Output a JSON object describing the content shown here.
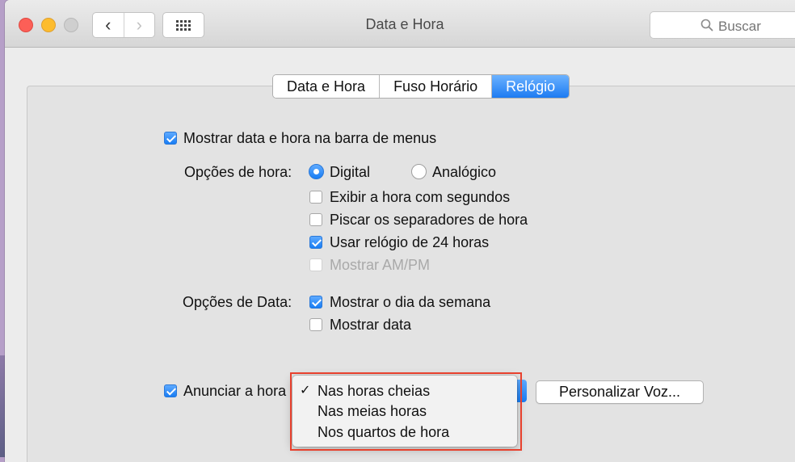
{
  "window": {
    "title": "Data e Hora",
    "search_placeholder": "Buscar"
  },
  "tabs": [
    {
      "label": "Data e Hora",
      "active": false
    },
    {
      "label": "Fuso Horário",
      "active": false
    },
    {
      "label": "Relógio",
      "active": true
    }
  ],
  "clock": {
    "show_menubar": {
      "label": "Mostrar data e hora na barra de menus",
      "checked": true
    },
    "time_options_label": "Opções de hora:",
    "digital": {
      "label": "Digital",
      "selected": true
    },
    "analog": {
      "label": "Analógico",
      "selected": false
    },
    "show_seconds": {
      "label": "Exibir a hora com segundos",
      "checked": false
    },
    "flash_separators": {
      "label": "Piscar os separadores de hora",
      "checked": false
    },
    "use_24h": {
      "label": "Usar relógio de 24 horas",
      "checked": true
    },
    "show_ampm": {
      "label": "Mostrar AM/PM",
      "checked": false,
      "disabled": true
    },
    "date_options_label": "Opções de Data:",
    "show_weekday": {
      "label": "Mostrar o dia da semana",
      "checked": true
    },
    "show_date": {
      "label": "Mostrar data",
      "checked": false
    },
    "announce": {
      "label": "Anunciar a hora",
      "checked": true
    },
    "customize_voice": "Personalizar Voz..."
  },
  "announce_menu": {
    "check_glyph": "✓",
    "options": [
      "Nas horas cheias",
      "Nas meias horas",
      "Nos quartos de hora"
    ],
    "selected_index": 0
  },
  "colors": {
    "accent": "#1d7bf2",
    "close": "#fc5f57",
    "minimize": "#fdbc2e",
    "annotation_box": "#e8412e"
  }
}
